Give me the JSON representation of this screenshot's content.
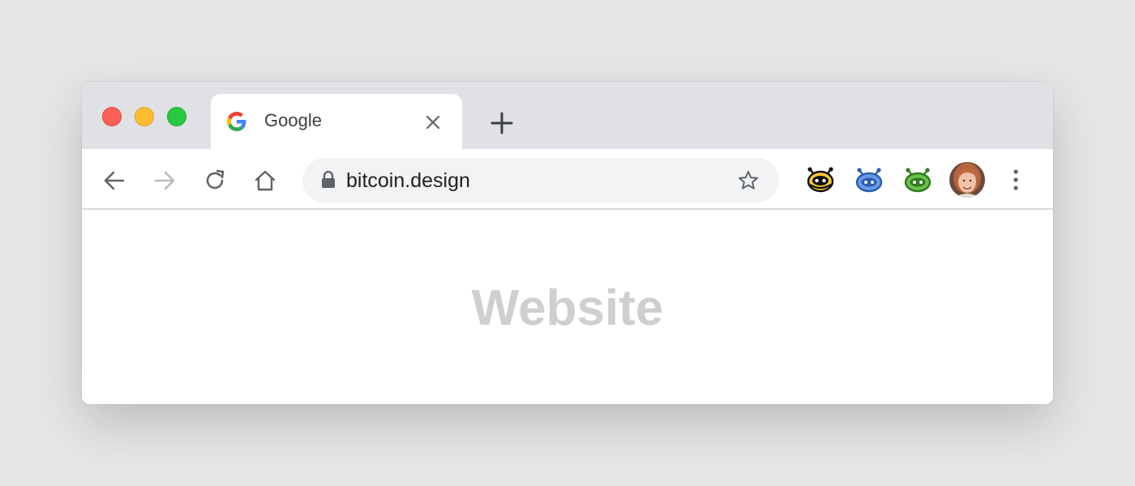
{
  "tab": {
    "title": "Google",
    "favicon_icon": "google-g-icon",
    "close_icon": "close-icon"
  },
  "tabstrip": {
    "new_tab_icon": "plus-icon"
  },
  "toolbar": {
    "back_icon": "arrow-left-icon",
    "forward_icon": "arrow-right-icon",
    "reload_icon": "reload-icon",
    "home_icon": "home-icon",
    "bookmark_icon": "star-icon",
    "menu_icon": "kebab-menu-icon",
    "extensions": [
      "bee-extension-icon",
      "blue-robot-extension-icon",
      "green-robot-extension-icon"
    ]
  },
  "omnibox": {
    "url": "bitcoin.design",
    "secure_icon": "lock-icon"
  },
  "page": {
    "label": "Website"
  },
  "colors": {
    "tabstrip_bg": "#dfe1e5",
    "close": "#fe5f57",
    "minimize": "#febc2e",
    "maximize": "#28c840",
    "omnibox_bg": "#f1f3f4",
    "placeholder_text": "#cfcfcf"
  }
}
